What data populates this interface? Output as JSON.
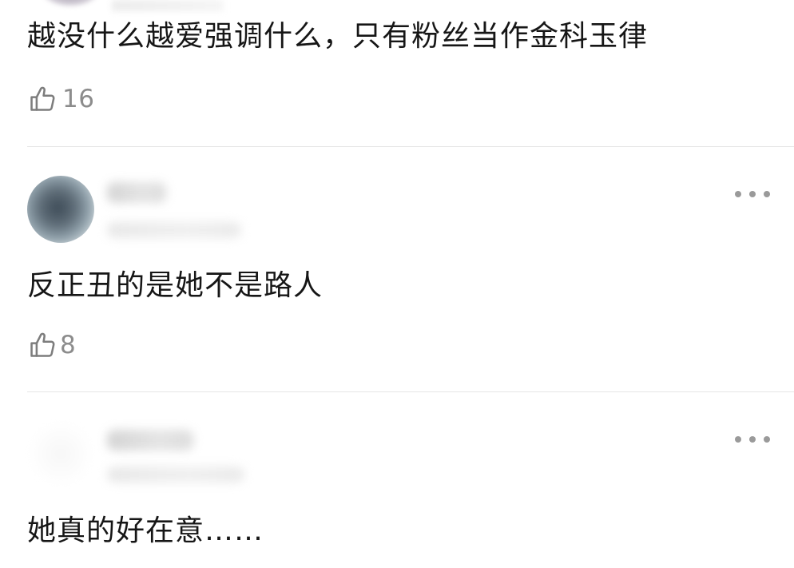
{
  "comments": [
    {
      "text": "越没什么越爱强调什么，只有粉丝当作金科玉律",
      "likes": "16",
      "like_icon": "thumbs-up-outline-icon"
    },
    {
      "text": "反正丑的是她不是路人",
      "likes": "8",
      "like_icon": "thumbs-up-outline-icon",
      "more_icon": "more-dots-icon"
    },
    {
      "text": "她真的好在意……",
      "more_icon": "more-dots-icon"
    }
  ],
  "colors": {
    "text": "#161616",
    "like_count": "#8c8c8c",
    "divider": "#e6e6e6",
    "more_dots": "#9a9a9a",
    "background": "#ffffff"
  }
}
